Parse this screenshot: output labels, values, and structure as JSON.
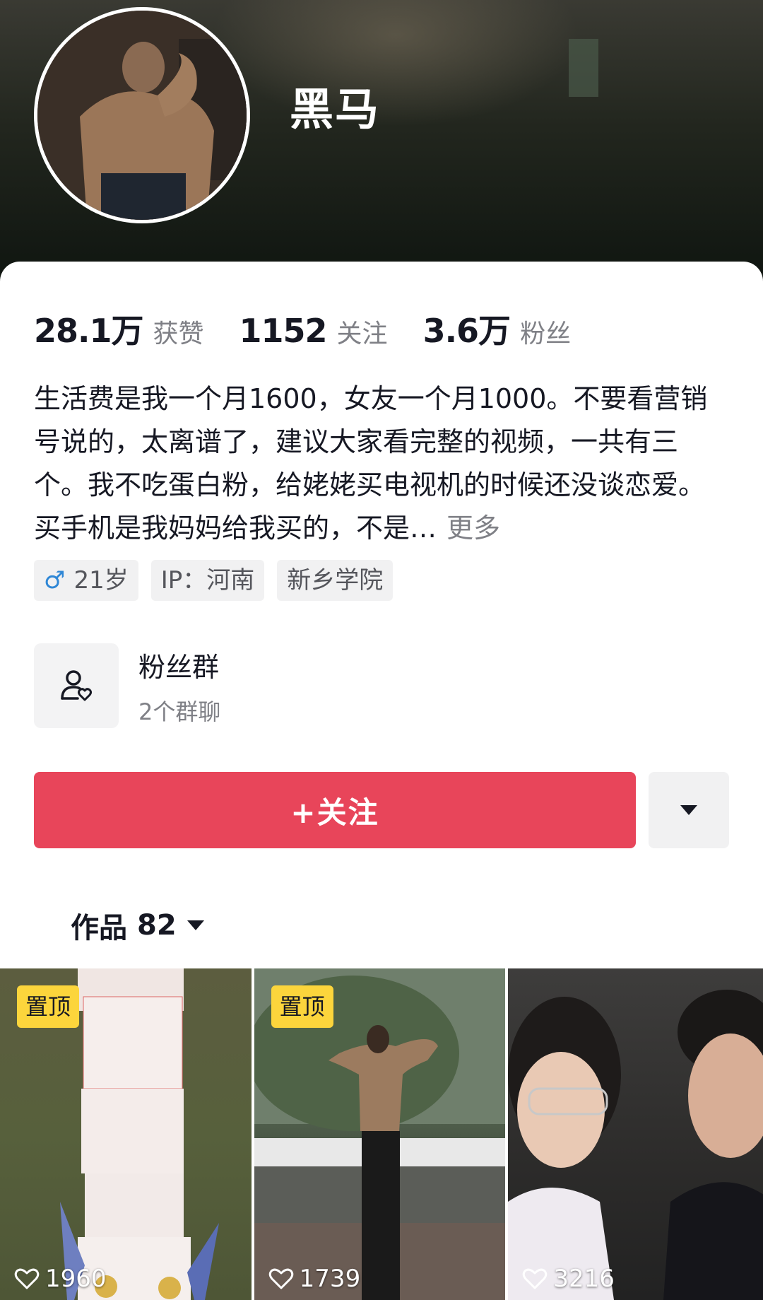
{
  "profile": {
    "name": "黑马"
  },
  "stats": [
    {
      "value": "28.1万",
      "label": "获赞"
    },
    {
      "value": "1152",
      "label": "关注"
    },
    {
      "value": "3.6万",
      "label": "粉丝"
    }
  ],
  "bio": {
    "text": "生活费是我一个月1600，女友一个月1000。不要看营销号说的，太离谱了，建议大家看完整的视频，一共有三个。我不吃蛋白粉，给姥姥买电视机的时候还没谈恋爱。买手机是我妈妈给我买的，不是…",
    "more": "更多"
  },
  "tags": {
    "gender_symbol": "♂",
    "age": "21岁",
    "ip": "IP：河南",
    "school": "新乡学院"
  },
  "fan_group": {
    "title": "粉丝群",
    "subtitle": "2个群聊"
  },
  "actions": {
    "follow_label": "+关注"
  },
  "works": {
    "label": "作品",
    "count": "82",
    "items": [
      {
        "pinned_label": "置顶",
        "likes": "1960"
      },
      {
        "pinned_label": "置顶",
        "likes": "1739"
      },
      {
        "pinned_label": "",
        "likes": "3216"
      }
    ]
  },
  "colors": {
    "follow_button": "#e8455a",
    "pin_badge": "#fcd53c",
    "male_icon": "#2f87d6"
  }
}
